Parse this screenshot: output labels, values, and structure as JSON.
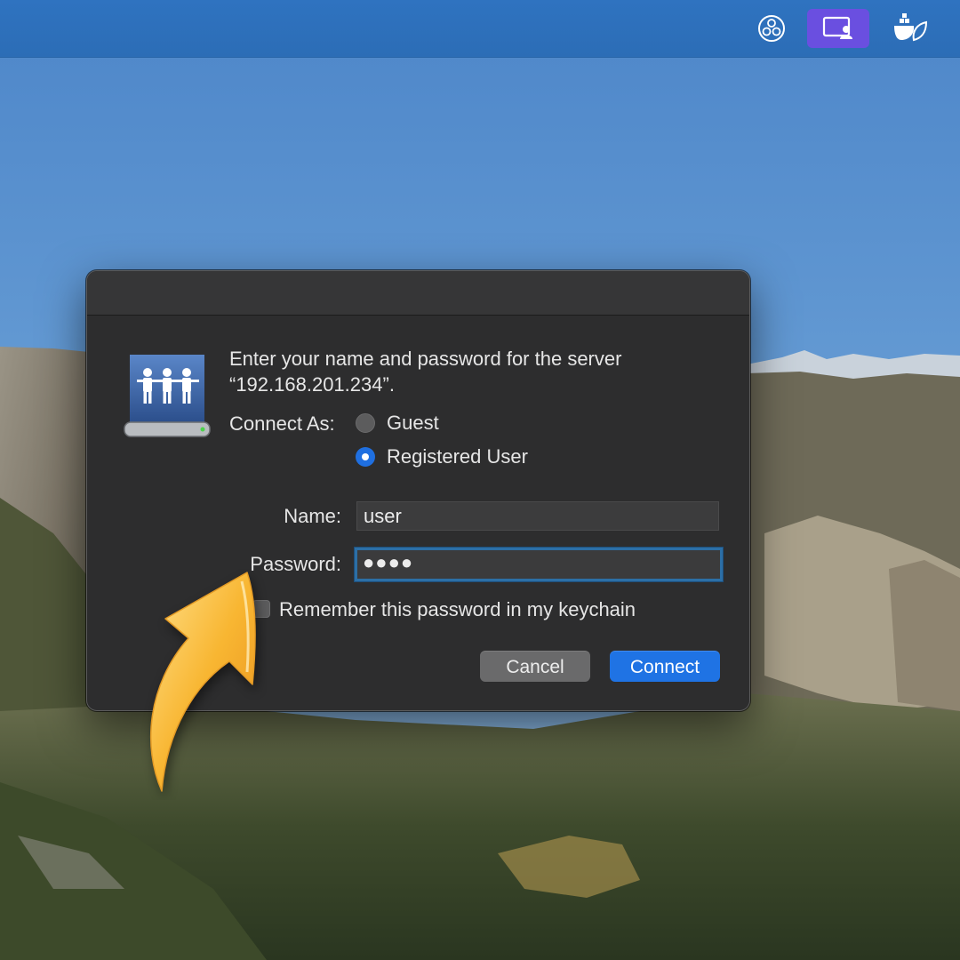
{
  "menubar": {
    "icons": [
      "obs-icon",
      "screen-share-icon",
      "docker-leaf-icon"
    ]
  },
  "dialog": {
    "prompt_line1": "Enter your name and password for the server",
    "prompt_line2": "“192.168.201.234”.",
    "connect_as_label": "Connect As:",
    "options": {
      "guest": "Guest",
      "registered": "Registered User",
      "selected": "Registered User"
    },
    "name_label": "Name:",
    "name_value": "user",
    "password_label": "Password:",
    "password_value": "●●●●",
    "remember_label": "Remember this password in my keychain",
    "remember_checked": false,
    "cancel_label": "Cancel",
    "connect_label": "Connect"
  },
  "colors": {
    "accent": "#1f73e4",
    "menubar": "#2f73c0",
    "active_menu_icon": "#6a4fe0",
    "arrow": "#f7b733"
  }
}
